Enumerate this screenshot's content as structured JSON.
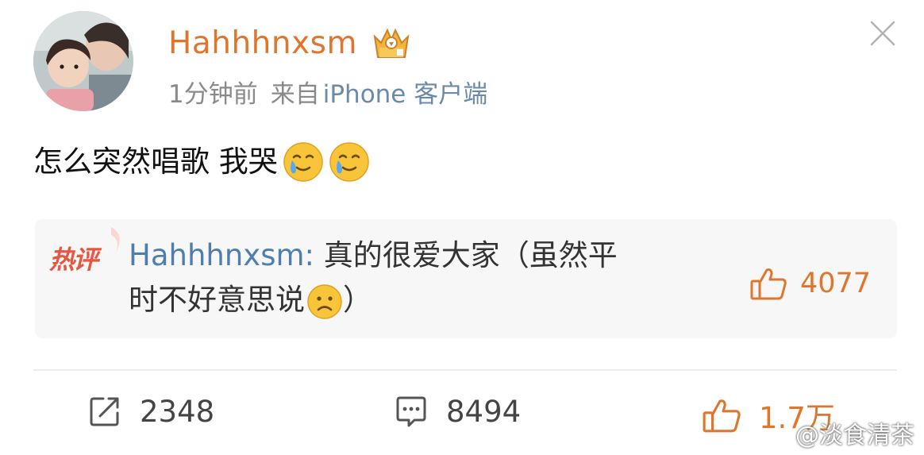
{
  "post": {
    "username": "Hahhhnxsm",
    "time": "1分钟前",
    "source_prefix": "来自",
    "client": "iPhone 客户端",
    "text": "怎么突然唱歌 我哭"
  },
  "hot_comment": {
    "badge": "热评",
    "author": "Hahhhnxsm:",
    "text_line1": " 真的很爱大家（虽然平",
    "text_line2": "时不好意思说",
    "text_tail": "）",
    "likes": "4077"
  },
  "actions": {
    "reposts": "2348",
    "comments": "8494",
    "likes": "1.7万"
  },
  "watermark": "@淡食清茶",
  "colors": {
    "username": "#e0762e",
    "link": "#4f7eae",
    "hot_badge": "#e85540"
  },
  "icons": [
    "avatar",
    "crown-badge-icon",
    "close-icon",
    "crying-smile-emoji",
    "sad-emoji",
    "thumbs-up-icon",
    "repost-icon",
    "comment-icon"
  ]
}
